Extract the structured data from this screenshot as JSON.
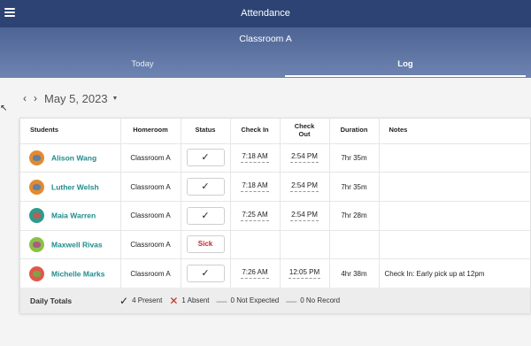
{
  "app": {
    "title": "Attendance"
  },
  "subheader": {
    "classroom": "Classroom A"
  },
  "tabs": [
    {
      "label": "Today",
      "active": false
    },
    {
      "label": "Log",
      "active": true
    }
  ],
  "date_nav": {
    "prev": "‹",
    "next": "›",
    "date": "May 5, 2023",
    "caret": "▼"
  },
  "table": {
    "headers": {
      "students": "Students",
      "homeroom": "Homeroom",
      "status": "Status",
      "check_in": "Check In",
      "check_out": "Check Out",
      "duration": "Duration",
      "notes": "Notes"
    },
    "rows": [
      {
        "name": "Alison Wang",
        "homeroom": "Classroom A",
        "status": "✓",
        "check_in": "7:18 AM",
        "check_out": "2:54 PM",
        "duration": "7hr 35m",
        "notes": ""
      },
      {
        "name": "Luther Welsh",
        "homeroom": "Classroom A",
        "status": "✓",
        "check_in": "7:18 AM",
        "check_out": "2:54 PM",
        "duration": "7hr 35m",
        "notes": ""
      },
      {
        "name": "Maia Warren",
        "homeroom": "Classroom A",
        "status": "✓",
        "check_in": "7:25 AM",
        "check_out": "2:54 PM",
        "duration": "7hr 28m",
        "notes": ""
      },
      {
        "name": "Maxwell Rivas",
        "homeroom": "Classroom A",
        "status": "Sick",
        "check_in": "",
        "check_out": "",
        "duration": "",
        "notes": ""
      },
      {
        "name": "Michelle Marks",
        "homeroom": "Classroom A",
        "status": "✓",
        "check_in": "7:26 AM",
        "check_out": "12:05 PM",
        "duration": "4hr 38m",
        "notes": "Check In: Early pick up at 12pm"
      }
    ]
  },
  "totals": {
    "label": "Daily Totals",
    "present": "4 Present",
    "absent": "1 Absent",
    "not_expected": "0 Not Expected",
    "no_record": "0 No Record"
  },
  "colors": {
    "header": "#2d4373",
    "subheader": "#6e84b1",
    "student_name": "#1f8c8c",
    "sick": "#c62828"
  },
  "icons": {
    "menu": "hamburger-menu-icon",
    "present": "check-icon",
    "absent": "x-icon",
    "not_expected": "dash-icon",
    "no_record": "dash-icon"
  }
}
